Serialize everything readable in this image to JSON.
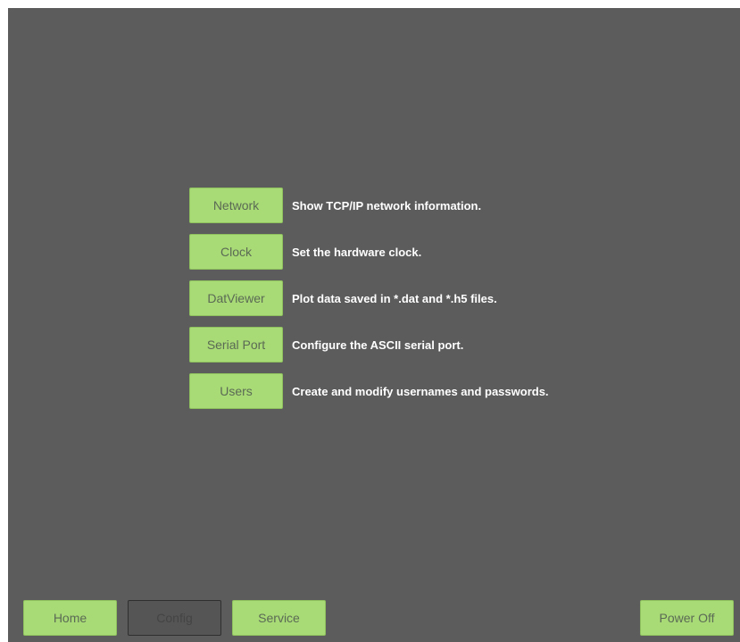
{
  "menu": {
    "items": [
      {
        "label": "Network",
        "description": "Show TCP/IP network information."
      },
      {
        "label": "Clock",
        "description": "Set the hardware clock."
      },
      {
        "label": "DatViewer",
        "description": "Plot data saved in *.dat and *.h5 files."
      },
      {
        "label": "Serial Port",
        "description": "Configure the ASCII serial port."
      },
      {
        "label": "Users",
        "description": "Create and modify usernames and passwords."
      }
    ]
  },
  "nav": {
    "home_label": "Home",
    "config_label": "Config",
    "service_label": "Service",
    "power_off_label": "Power Off",
    "active": "Config"
  },
  "colors": {
    "background": "#5c5c5c",
    "button": "#a8db76",
    "active_button": "#555555"
  }
}
